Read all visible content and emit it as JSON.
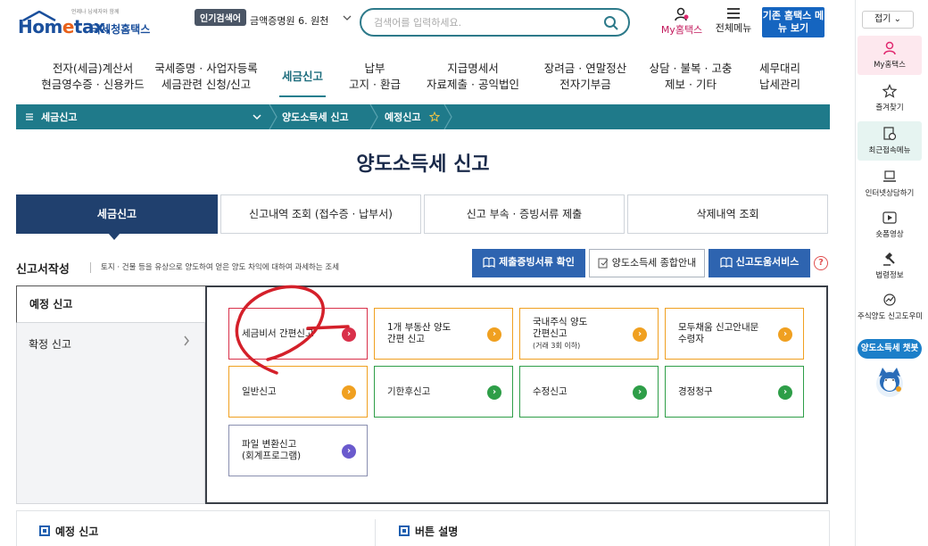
{
  "header": {
    "logo_tag": "언제나 납세자와 함께",
    "logo_text_1": "Hom",
    "logo_text_2": "e",
    "logo_text_3": "tax.",
    "logo_sub": "국세청홈택스",
    "popular_badge": "인기검색어",
    "popular_rank": "",
    "popular_term": "금액증명원 6. 원천",
    "search_placeholder": "검색어를 입력하세요.",
    "my_hometax": "My홈택스",
    "all_menu": "전체메뉴",
    "old_hometax": "기존 홈택스 메뉴 보기"
  },
  "gnb": [
    {
      "line1": "전자(세금)계산서",
      "line2": "현금영수증 · 신용카드"
    },
    {
      "line1": "국세증명 · 사업자등록",
      "line2": "세금관련 신청/신고"
    },
    {
      "line1": "세금신고",
      "line2": ""
    },
    {
      "line1": "납부",
      "line2": "고지 · 환급"
    },
    {
      "line1": "지급명세서",
      "line2": "자료제출 · 공익법인"
    },
    {
      "line1": "장려금 · 연말정산",
      "line2": "전자기부금"
    },
    {
      "line1": "상담 · 불복 · 고충",
      "line2": "제보 · 기타"
    },
    {
      "line1": "세무대리",
      "line2": "납세관리"
    }
  ],
  "breadcrumb": {
    "menu": "세금신고",
    "level2": "양도소득세 신고",
    "level3": "예정신고"
  },
  "page_title": "양도소득세 신고",
  "tabs": [
    "세금신고",
    "신고내역 조회 (접수증 · 납부서)",
    "신고 부속 · 증빙서류 제출",
    "삭제내역 조회"
  ],
  "section": {
    "title": "신고서작성",
    "desc": "토지 · 건물 등을 유상으로 양도하여 얻은 양도 차익에 대하여 과세하는 조세",
    "btn_docs": "제출증빙서류 확인",
    "btn_guide": "양도소득세 종합안내",
    "btn_help": "신고도움서비스",
    "help_q": "?"
  },
  "side": {
    "first": "예정 신고",
    "second": "확정 신고"
  },
  "cards": [
    {
      "label": "세금비서 간편신고",
      "sub": "",
      "color": "#d9304a"
    },
    {
      "label": "1개 부동산 양도",
      "label2": "간편 신고",
      "sub": "",
      "color": "#f0a020"
    },
    {
      "label": "국내주식 양도",
      "label2": "간편신고",
      "sub": "(거래 3회 이하)",
      "color": "#f0a020"
    },
    {
      "label": "모두채움 신고안내문",
      "label2": "수령자",
      "sub": "",
      "color": "#f0a020"
    },
    {
      "label": "일반신고",
      "sub": "",
      "color": "#f0a020"
    },
    {
      "label": "기한후신고",
      "sub": "",
      "color": "#2e9e48"
    },
    {
      "label": "수정신고",
      "sub": "",
      "color": "#2e9e48"
    },
    {
      "label": "경정청구",
      "sub": "",
      "color": "#2e9e48"
    },
    {
      "label": "파일 변환신고",
      "label2": "(회계프로그램)",
      "sub": "",
      "color": "#6a5acd"
    }
  ],
  "bottom": {
    "left": "예정 신고",
    "right": "버튼 설명"
  },
  "rail": {
    "fold": "접기",
    "items": [
      "My홈택스",
      "즐겨찾기",
      "최근접속메뉴",
      "인터넷상담하기",
      "숏폼영상",
      "법령정보",
      "주식양도 신고도우미"
    ],
    "chatbot": "양도소득세 챗봇"
  }
}
